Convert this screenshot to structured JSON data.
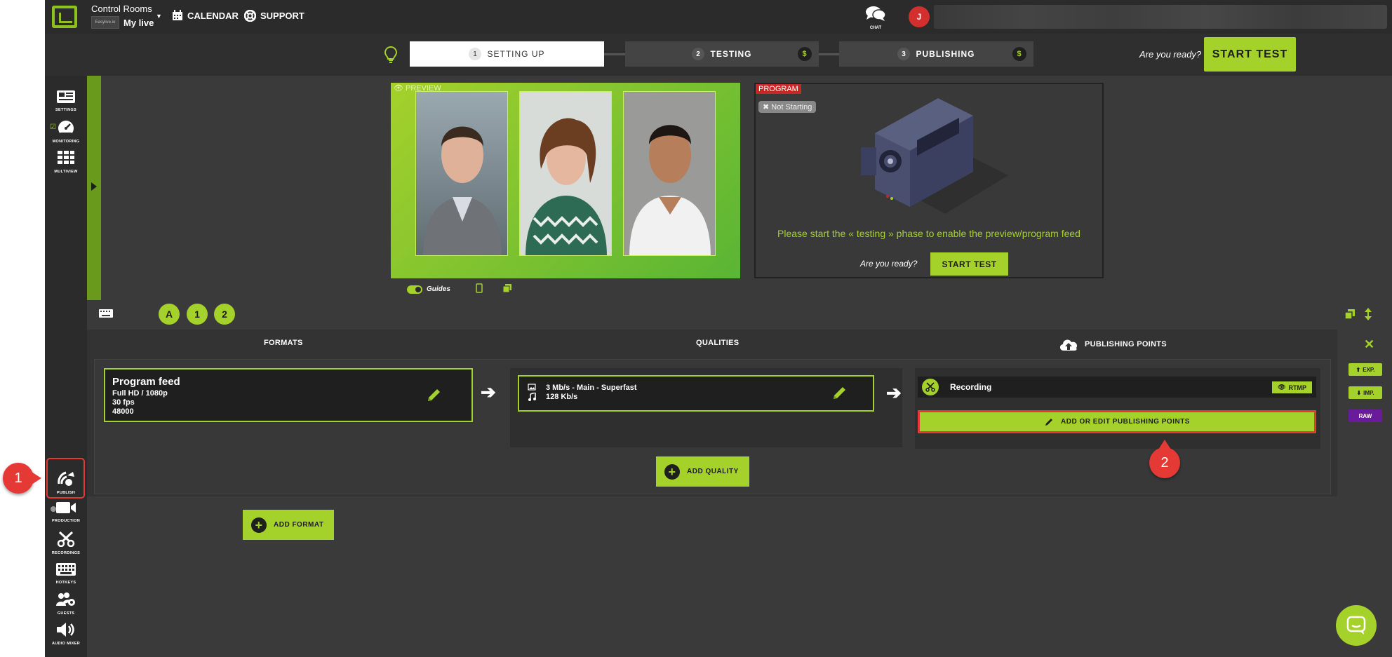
{
  "topbar": {
    "title": "Control Rooms",
    "live_name": "My live",
    "thumb_text": "Easylive.io",
    "nav_calendar": "CALENDAR",
    "nav_support": "SUPPORT",
    "chat_label": "CHAT",
    "avatar_initial": "J"
  },
  "steps": {
    "step1_num": "1",
    "step1_label": "SETTING UP",
    "step2_num": "2",
    "step2_label": "TESTING",
    "step3_num": "3",
    "step3_label": "PUBLISHING",
    "dollar": "$",
    "ready_text": "Are you ready?",
    "start_label": "START TEST"
  },
  "sidebar": {
    "settings": "SETTINGS",
    "monitoring": "MONITORING",
    "multiview": "MULTIVIEW",
    "publish": "PUBLISH",
    "production": "PRODUCTION",
    "recordings": "RECORDINGS",
    "hotkeys": "HOTKEYS",
    "guests": "GUESTS",
    "audio_mixer": "AUDIO MIXER"
  },
  "callouts": {
    "one": "1",
    "two": "2"
  },
  "preview": {
    "label": "PREVIEW"
  },
  "program": {
    "label": "PROGRAM",
    "status": "Not Starting",
    "message": "Please start the « testing » phase to enable the preview/program feed",
    "ready_text": "Are you ready?",
    "start_label": "START TEST"
  },
  "guides": {
    "label": "Guides"
  },
  "shortcuts": [
    "A",
    "1",
    "2"
  ],
  "panel": {
    "formats_header": "FORMATS",
    "qualities_header": "QUALITIES",
    "publishing_header": "PUBLISHING POINTS",
    "format": {
      "title": "Program feed",
      "resolution": "Full HD / 1080p",
      "fps": "30 fps",
      "sample_rate": "48000"
    },
    "quality": {
      "video": "3 Mb/s  -  Main  -  Superfast",
      "audio": "128 Kb/s"
    },
    "publishing_point": {
      "name": "Recording",
      "protocol": "RTMP"
    },
    "add_edit_label": "ADD OR EDIT PUBLISHING POINTS",
    "add_quality_label": "ADD QUALITY",
    "add_format_label": "ADD FORMAT"
  },
  "right_tools": {
    "export": "EXP.",
    "import": "IMP.",
    "raw": "RAW"
  },
  "colors": {
    "accent": "#a5d12b",
    "background": "#3a3a3a",
    "highlight": "#e53935",
    "raw": "#6a1b9a"
  }
}
